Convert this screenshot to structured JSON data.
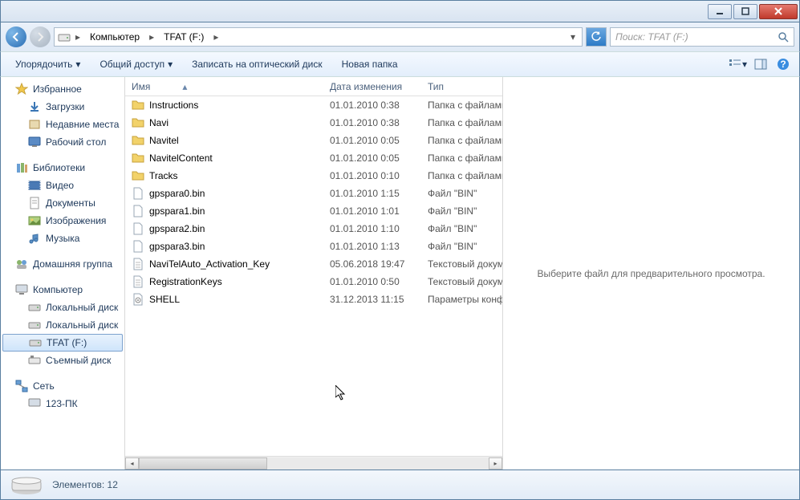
{
  "window": {
    "title": "TFAT (F:)"
  },
  "breadcrumb": {
    "root": "Компьютер",
    "current": "TFAT (F:)"
  },
  "search": {
    "placeholder": "Поиск: TFAT (F:)"
  },
  "toolbar": {
    "organize": "Упорядочить",
    "share": "Общий доступ",
    "burn": "Записать на оптический диск",
    "new_folder": "Новая папка"
  },
  "sidebar": {
    "favorites": {
      "label": "Избранное",
      "items": [
        "Загрузки",
        "Недавние места",
        "Рабочий стол"
      ]
    },
    "libraries": {
      "label": "Библиотеки",
      "items": [
        "Видео",
        "Документы",
        "Изображения",
        "Музыка"
      ]
    },
    "homegroup": {
      "label": "Домашняя группа"
    },
    "computer": {
      "label": "Компьютер",
      "items": [
        "Локальный диск",
        "Локальный диск",
        "TFAT (F:)",
        "Съемный диск"
      ]
    },
    "network": {
      "label": "Сеть",
      "items": [
        "123-ПК"
      ]
    }
  },
  "columns": {
    "name": "Имя",
    "date": "Дата изменения",
    "type": "Тип"
  },
  "files": [
    {
      "icon": "folder",
      "name": "Instructions",
      "date": "01.01.2010 0:38",
      "type": "Папка с файлами"
    },
    {
      "icon": "folder",
      "name": "Navi",
      "date": "01.01.2010 0:38",
      "type": "Папка с файлами"
    },
    {
      "icon": "folder",
      "name": "Navitel",
      "date": "01.01.2010 0:05",
      "type": "Папка с файлами"
    },
    {
      "icon": "folder",
      "name": "NavitelContent",
      "date": "01.01.2010 0:05",
      "type": "Папка с файлами"
    },
    {
      "icon": "folder",
      "name": "Tracks",
      "date": "01.01.2010 0:10",
      "type": "Папка с файлами"
    },
    {
      "icon": "file",
      "name": "gpspara0.bin",
      "date": "01.01.2010 1:15",
      "type": "Файл \"BIN\""
    },
    {
      "icon": "file",
      "name": "gpspara1.bin",
      "date": "01.01.2010 1:01",
      "type": "Файл \"BIN\""
    },
    {
      "icon": "file",
      "name": "gpspara2.bin",
      "date": "01.01.2010 1:10",
      "type": "Файл \"BIN\""
    },
    {
      "icon": "file",
      "name": "gpspara3.bin",
      "date": "01.01.2010 1:13",
      "type": "Файл \"BIN\""
    },
    {
      "icon": "text",
      "name": "NaviTelAuto_Activation_Key",
      "date": "05.06.2018 19:47",
      "type": "Текстовый документ"
    },
    {
      "icon": "text",
      "name": "RegistrationKeys",
      "date": "01.01.2010 0:50",
      "type": "Текстовый документ"
    },
    {
      "icon": "ini",
      "name": "SHELL",
      "date": "31.12.2013 11:15",
      "type": "Параметры конфигурации"
    }
  ],
  "preview": {
    "message": "Выберите файл для предварительного просмотра."
  },
  "status": {
    "count_label": "Элементов: 12"
  }
}
